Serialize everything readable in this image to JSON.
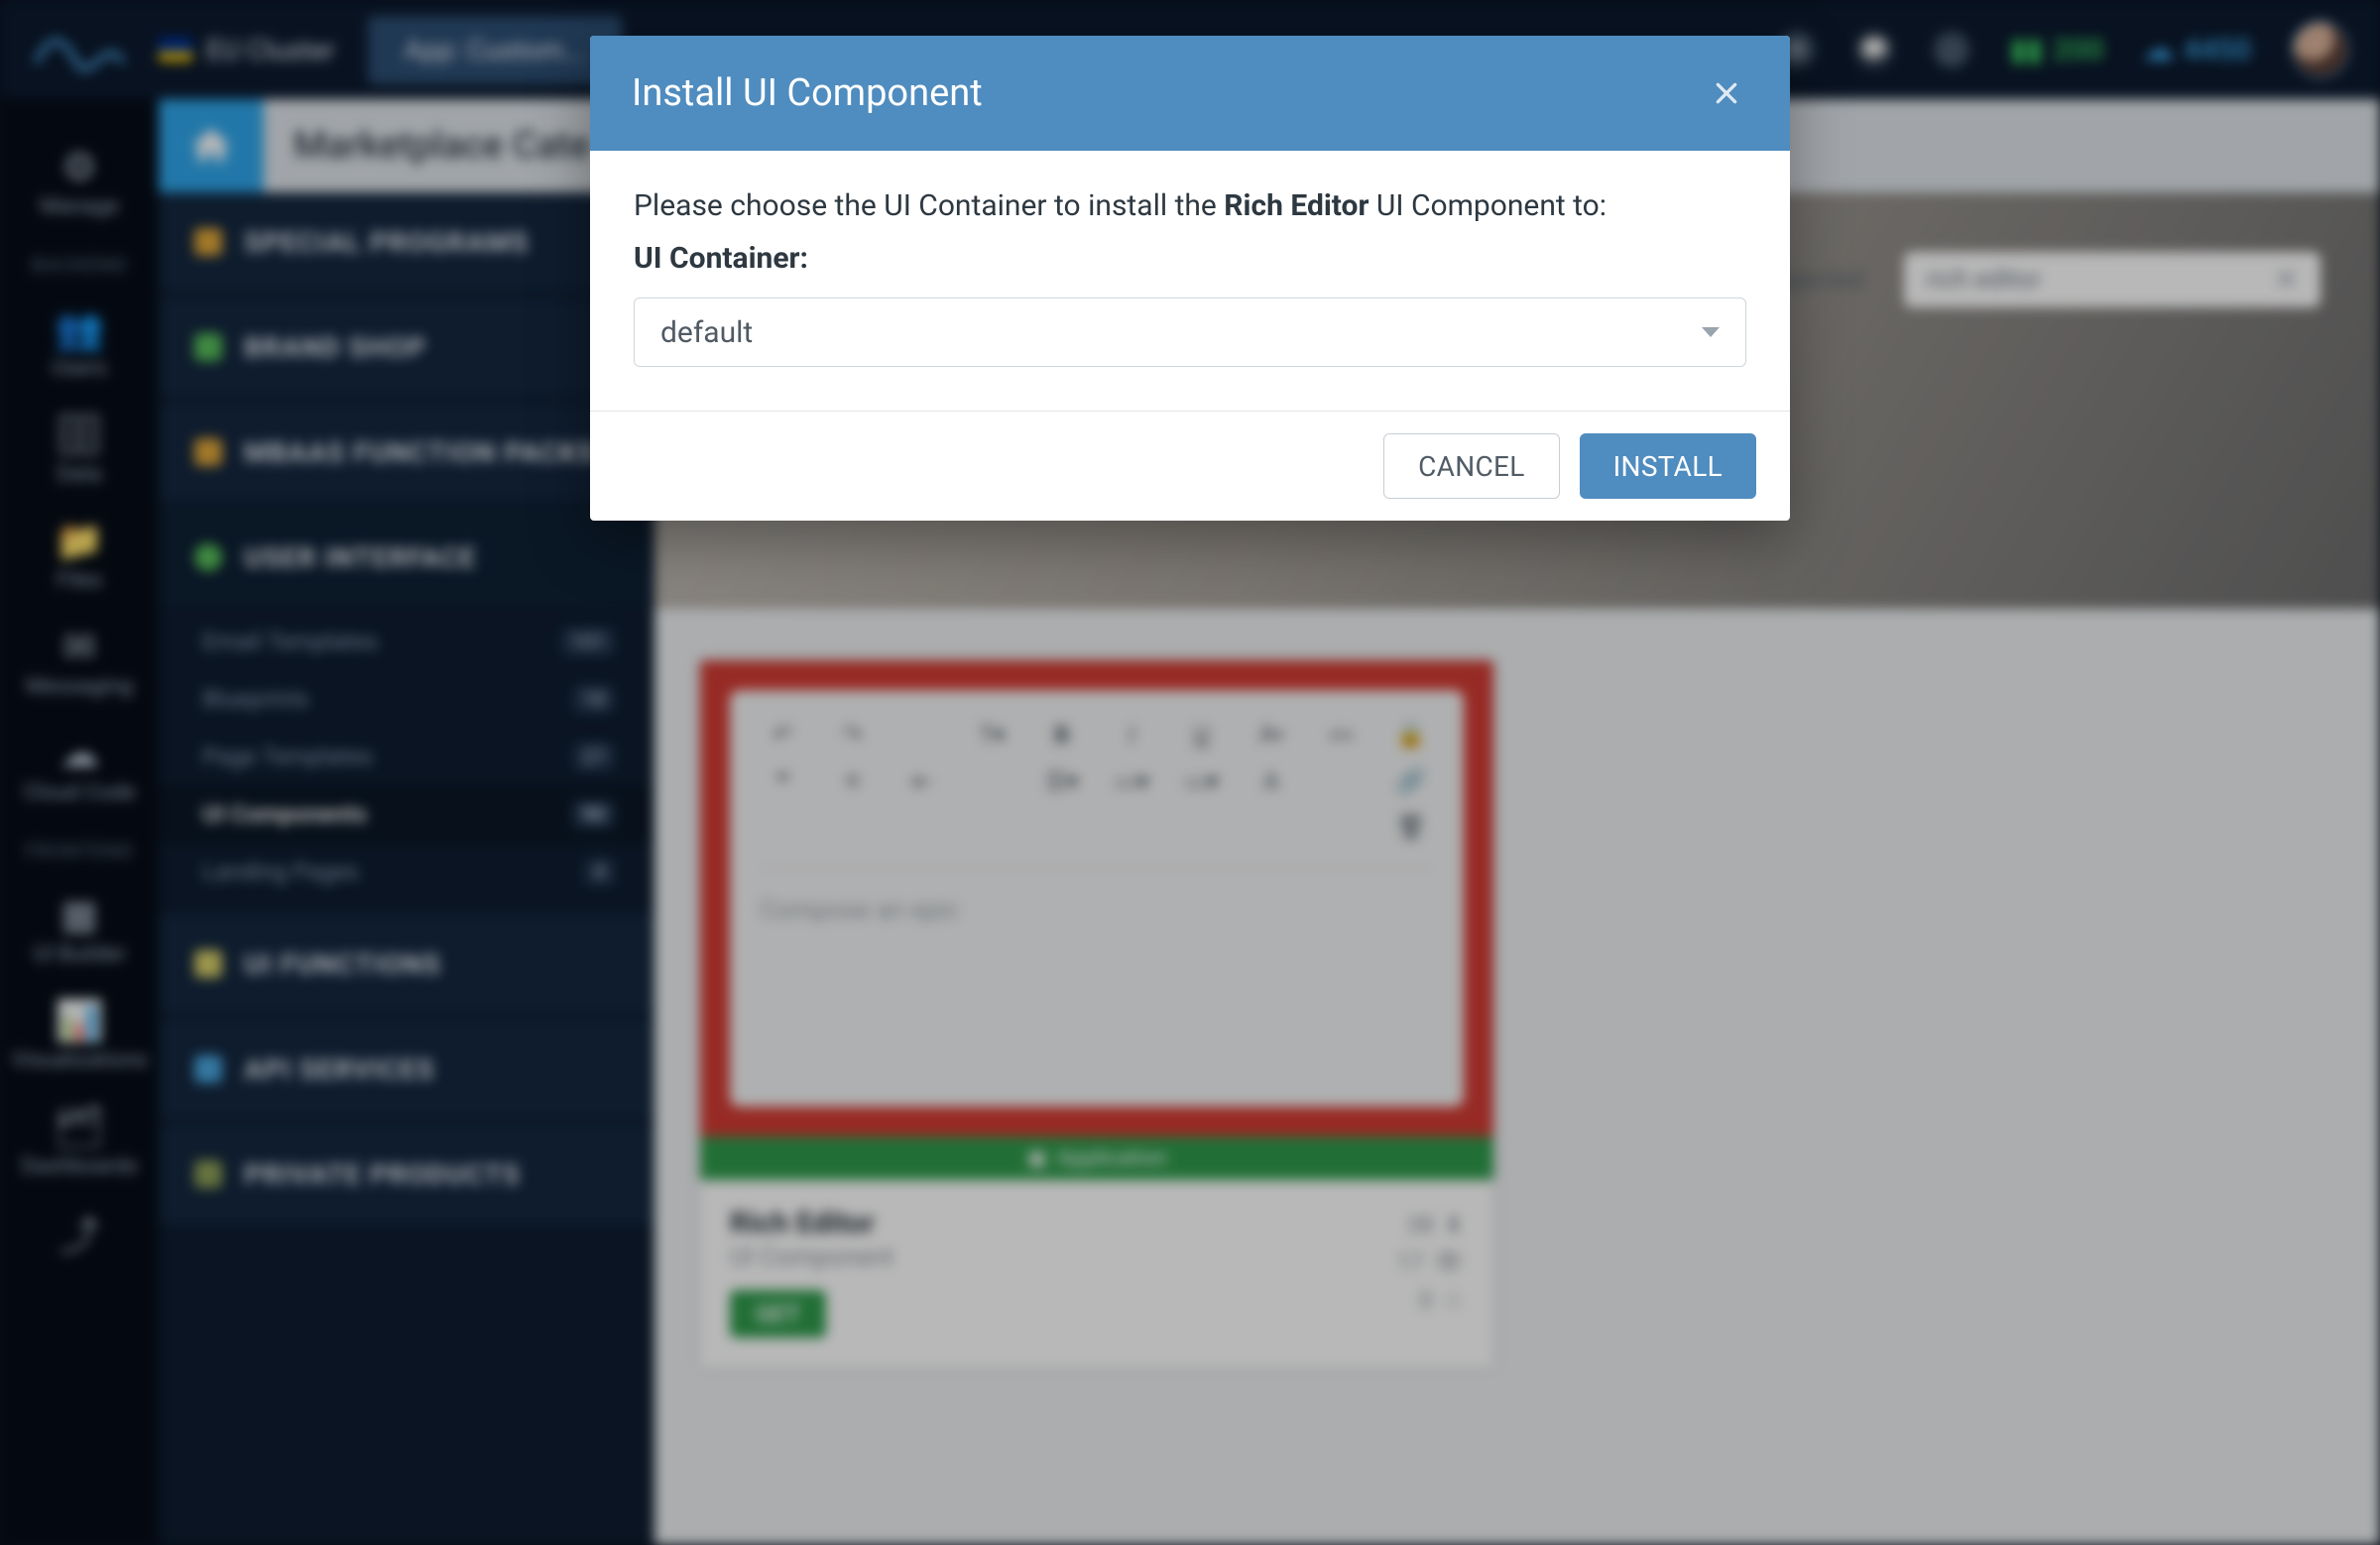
{
  "topbar": {
    "cluster_label": "EU Cluster",
    "app_label": "App: Custom...",
    "credits_green": "200",
    "credits_blue": "4450"
  },
  "rail": {
    "backend_label": "BACKEND",
    "frontend_label": "FRONTEND",
    "items": [
      {
        "label": "Manage"
      },
      {
        "label": "Users"
      },
      {
        "label": "Data"
      },
      {
        "label": "Files"
      },
      {
        "label": "Messaging"
      },
      {
        "label": "Cloud Code"
      },
      {
        "label": "UI Builder"
      },
      {
        "label": "Visualizations"
      },
      {
        "label": "Dashboards"
      }
    ]
  },
  "pagehead": {
    "title": "Marketplace Cate"
  },
  "catnav": {
    "groups": [
      {
        "label": "SPECIAL PROGRAMS",
        "color": "#e2a83a"
      },
      {
        "label": "BRAND SHOP",
        "color": "#58c05b"
      },
      {
        "label": "MBAAS FUNCTION PACKS",
        "color": "#e2a83a"
      },
      {
        "label": "USER INTERFACE",
        "color": "#58c05b"
      },
      {
        "label": "UI FUNCTIONS",
        "color": "#d9d06a"
      },
      {
        "label": "API SERVICES",
        "color": "#4aa7e0"
      },
      {
        "label": "PRIVATE PRODUCTS",
        "color": "#8fa158"
      }
    ],
    "subs": [
      {
        "label": "Email Templates",
        "badge": "101"
      },
      {
        "label": "Blueprints",
        "badge": "18"
      },
      {
        "label": "Page Templates",
        "badge": "27"
      },
      {
        "label": "UI Components",
        "badge": "90"
      },
      {
        "label": "Landing Pages",
        "badge": "4"
      }
    ]
  },
  "filters": {
    "tabs": [
      "Rejected"
    ],
    "search_value": "rich editor"
  },
  "card": {
    "appbar_label": "Application",
    "title": "Rich Editor",
    "subtitle": "UI Component",
    "placeholder": "Compose an epic",
    "get_label": "GET",
    "stats": {
      "downloads": "38",
      "views": "17",
      "stars": "0"
    }
  },
  "modal": {
    "title": "Install UI Component",
    "prompt_prefix": "Please choose the UI Container to install the ",
    "prompt_component": "Rich Editor",
    "prompt_suffix": " UI Component to:",
    "field_label": "UI Container:",
    "selected_value": "default",
    "cancel_label": "CANCEL",
    "install_label": "INSTALL"
  }
}
